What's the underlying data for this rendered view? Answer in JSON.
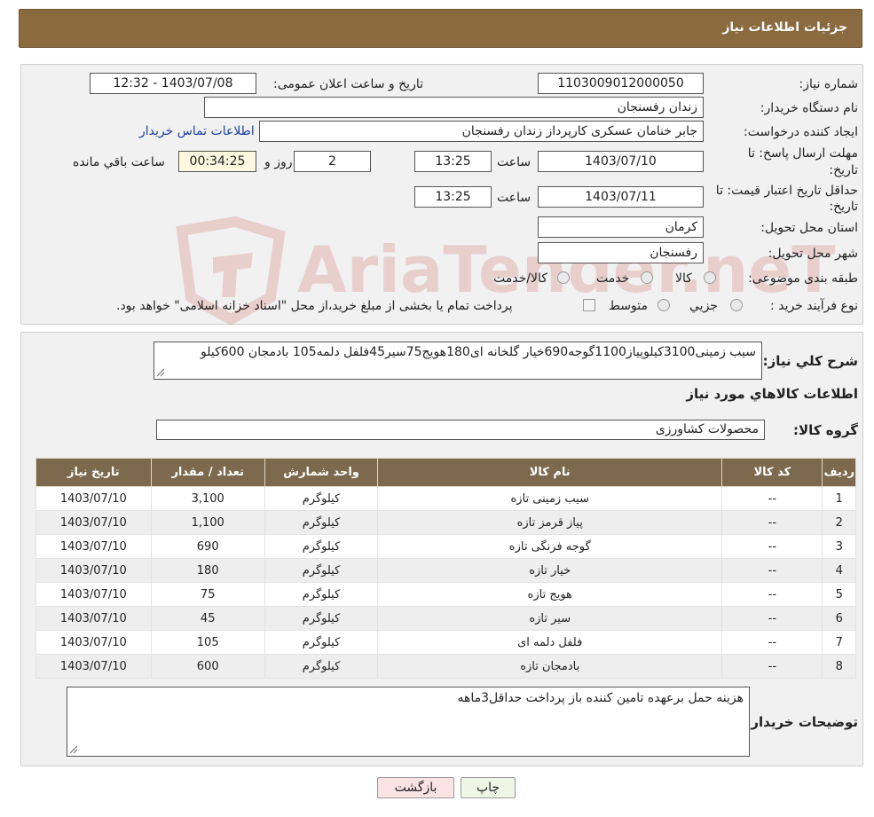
{
  "header": {
    "title": "جزئیات اطلاعات نیاز"
  },
  "form": {
    "need_number_label": "شماره نیاز:",
    "need_number": "1103009012000050",
    "announce_label": "تاریخ و ساعت اعلان عمومی:",
    "announce_value": "1403/07/08 - 12:32",
    "buyer_org_label": "نام دستگاه خریدار:",
    "buyer_org": "زندان رفسنجان",
    "creator_label": "ایجاد کننده درخواست:",
    "creator": "جابر خنامان عسکری کارپرداز زندان رفسنجان",
    "contact_link": "اطلاعات تماس خریدار",
    "deadline_label_1": "مهلت ارسال پاسخ: تا",
    "deadline_label_2": "تاریخ:",
    "deadline_date": "1403/07/10",
    "time_label": "ساعت",
    "deadline_time": "13:25",
    "days_value": "2",
    "days_label": "روز و",
    "remaining_value": "00:34:25",
    "remaining_label": "ساعت باقي مانده",
    "validity_label_1": "حداقل تاریخ اعتبار قیمت: تا",
    "validity_label_2": "تاریخ:",
    "validity_date": "1403/07/11",
    "validity_time": "13:25",
    "province_label": "استان محل تحویل:",
    "province": "کرمان",
    "city_label": "شهر محل تحویل:",
    "city": "رفسنجان",
    "category_label": "طبقه بندی موضوعی:",
    "category_options": [
      "کالا",
      "خدمت",
      "کالا/خدمت"
    ],
    "process_label": "نوع فرآیند خرید :",
    "process_options": [
      "جزیي",
      "متوسط"
    ],
    "process_note": "پرداخت تمام یا بخشی از مبلغ خرید،از محل \"اسناد خزانه اسلامی\" خواهد بود."
  },
  "details": {
    "summary_label": "شرح کلي نياز:",
    "summary": "سیب زمینی3100کیلوپیاز1100گوجه690خیار گلخانه ای180هویج75سیر45فلفل دلمه105 بادمجان 600کیلو",
    "goods_info_title": "اطلاعات کالاهاي مورد نياز",
    "group_label": "گروه کالا:",
    "group_value": "محصولات کشاورزی"
  },
  "table": {
    "headers": [
      "ردیف",
      "کد کالا",
      "نام کالا",
      "واحد شمارش",
      "تعداد / مقدار",
      "تاریخ نیاز"
    ],
    "rows": [
      [
        "1",
        "--",
        "سیب زمینی تازه",
        "کیلوگرم",
        "3,100",
        "1403/07/10"
      ],
      [
        "2",
        "--",
        "پیاز قرمز تازه",
        "کیلوگرم",
        "1,100",
        "1403/07/10"
      ],
      [
        "3",
        "--",
        "گوجه فرنگی تازه",
        "کیلوگرم",
        "690",
        "1403/07/10"
      ],
      [
        "4",
        "--",
        "خیار تازه",
        "کیلوگرم",
        "180",
        "1403/07/10"
      ],
      [
        "5",
        "--",
        "هویج تازه",
        "کیلوگرم",
        "75",
        "1403/07/10"
      ],
      [
        "6",
        "--",
        "سیر تازه",
        "کیلوگرم",
        "45",
        "1403/07/10"
      ],
      [
        "7",
        "--",
        "فلفل دلمه ای",
        "کیلوگرم",
        "105",
        "1403/07/10"
      ],
      [
        "8",
        "--",
        "بادمجان تازه",
        "کیلوگرم",
        "600",
        "1403/07/10"
      ]
    ]
  },
  "buyer_notes": {
    "label": "توضیحات خریدار:",
    "text": "هزینه حمل برعهده تامین کننده باز پرداخت حداقل3ماهه"
  },
  "buttons": {
    "print": "چاپ",
    "back": "بازگشت"
  },
  "watermark": {
    "text": "AriaTender.neT"
  }
}
